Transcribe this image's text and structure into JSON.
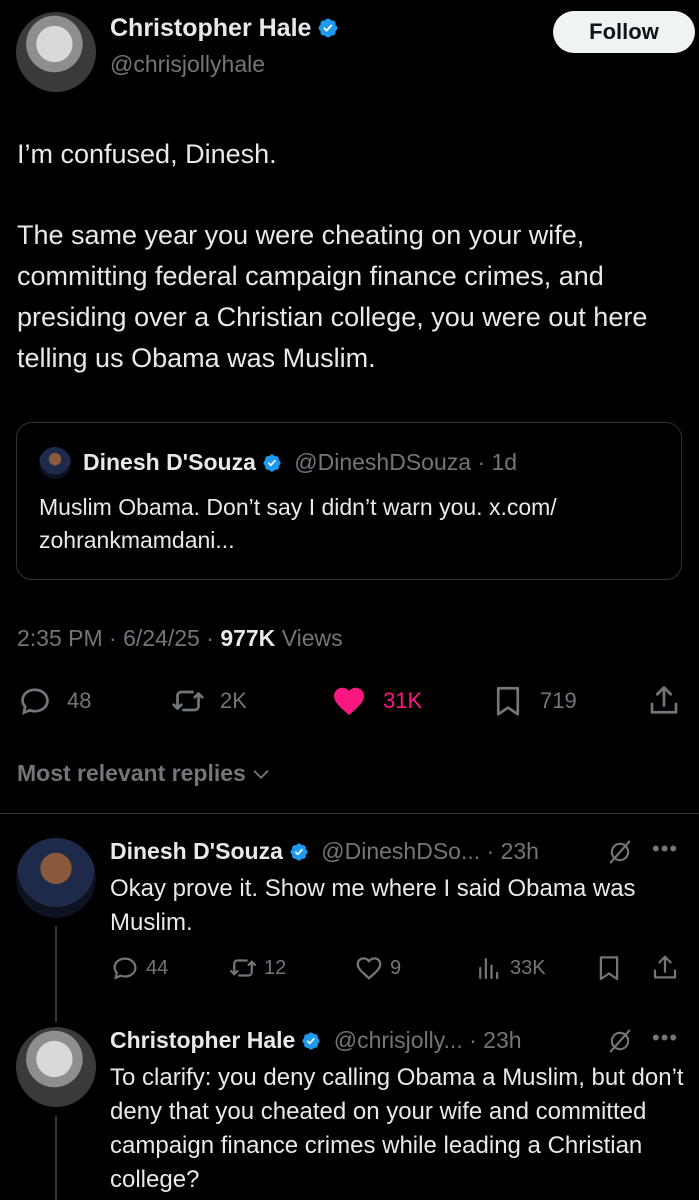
{
  "main_tweet": {
    "author_name": "Christopher Hale",
    "author_handle": "@chrisjollyhale",
    "follow_label": "Follow",
    "text_line1": "I’m confused, Dinesh.",
    "text_body": "The same year you were cheating on your wife, committing federal campaign finance crimes, and presiding over a Christian college, you were out here telling us Obama was Muslim.",
    "quote": {
      "author_name": "Dinesh D'Souza",
      "author_handle": "@DineshDSouza",
      "time": "· 1d",
      "text": "Muslim Obama. Don’t say I didn’t warn you. x.com/ zohrankmamdani..."
    },
    "meta": {
      "time": "2:35 PM",
      "dot1": "·",
      "date": "6/24/25",
      "dot2": "·",
      "views_count": "977K",
      "views_label": "Views"
    },
    "actions": {
      "replies": "48",
      "reposts": "2K",
      "likes": "31K",
      "bookmarks": "719"
    }
  },
  "replies_header": "Most relevant replies",
  "replies": [
    {
      "author_name": "Dinesh D'Souza",
      "author_handle": "@DineshDSo...",
      "time": "· 23h",
      "text": "Okay prove it. Show me where I said Obama was Muslim.",
      "actions": {
        "replies": "44",
        "reposts": "12",
        "likes": "9",
        "views": "33K"
      }
    },
    {
      "author_name": "Christopher Hale",
      "author_handle": "@chrisjolly...",
      "time": "· 23h",
      "text": "To clarify: you deny calling Obama a Muslim, but don’t deny that you cheated on your wife and committed campaign finance crimes while leading a Christian college?"
    }
  ],
  "colors": {
    "background": "#000000",
    "text": "#e7e9ea",
    "muted": "#71767b",
    "like_pink": "#f91880",
    "verified_blue": "#1d9bf0",
    "border": "#2f3336"
  }
}
